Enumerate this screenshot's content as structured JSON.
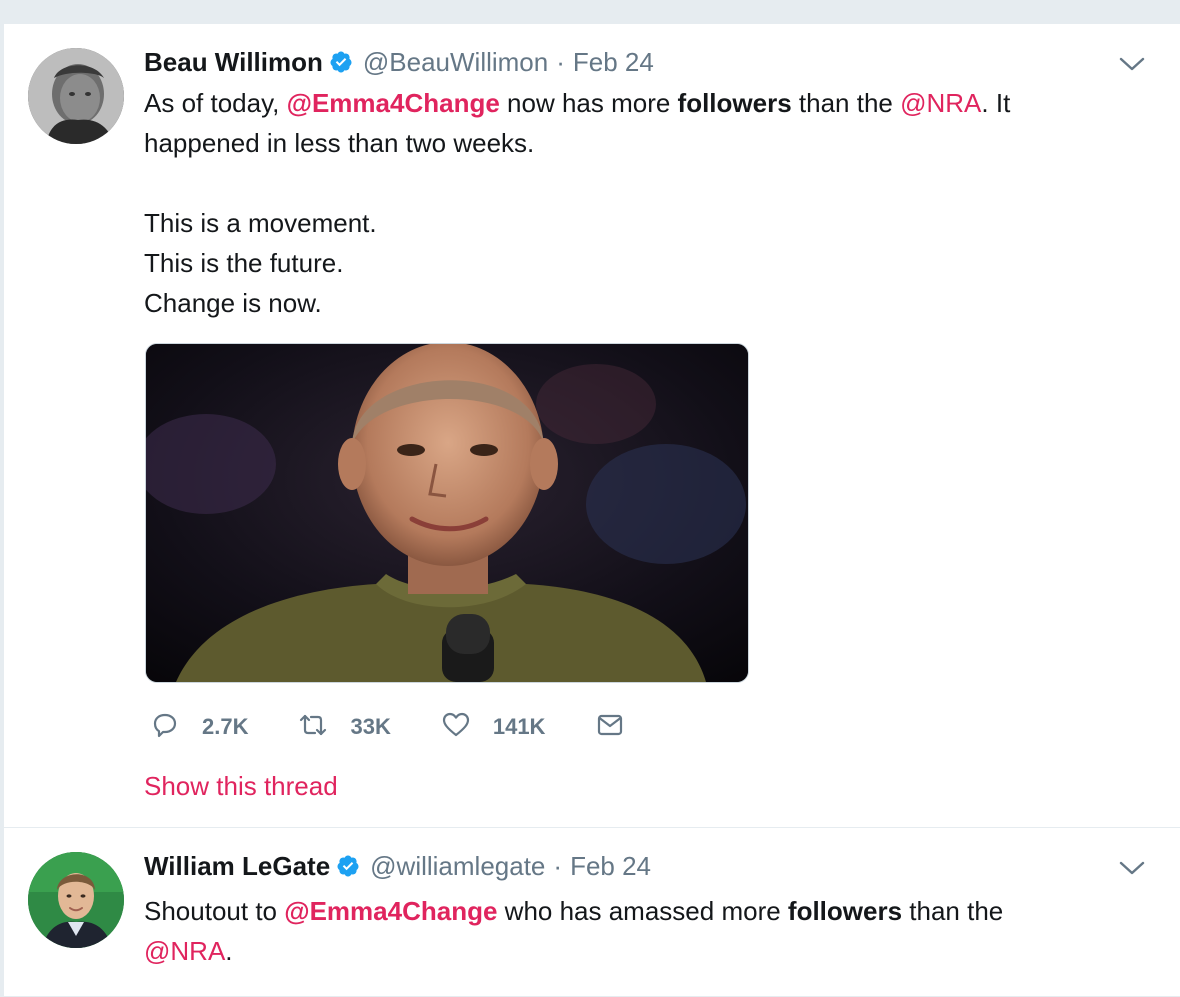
{
  "tweets": [
    {
      "name": "Beau Willimon",
      "handle": "@BeauWillimon",
      "separator": "·",
      "date": "Feb 24",
      "text": {
        "l1_a": "As of today, ",
        "l1_m1": "@Emma4Change",
        "l1_b": " now has more ",
        "l1_kw": "followers",
        "l1_c": " than the ",
        "l1_m2": "@NRA",
        "l1_d": ". It",
        "l2": "happened in less than two weeks.",
        "l4": "This is a movement.",
        "l5": "This is the future.",
        "l6": "Change is now."
      },
      "media": {
        "description_icon": "photo"
      },
      "actions": {
        "replies": "2.7K",
        "retweets": "33K",
        "likes": "141K"
      },
      "show_thread": "Show this thread"
    },
    {
      "name": "William LeGate",
      "handle": "@williamlegate",
      "separator": "·",
      "date": "Feb 24",
      "text": {
        "l1_a": "Shoutout to ",
        "l1_m1": "@Emma4Change",
        "l1_b": " who has amassed more ",
        "l1_kw": "followers",
        "l1_c": " than the",
        "l2_m": "@NRA",
        "l2_b": "."
      }
    }
  ],
  "icons": {
    "verified": "verified-badge-icon",
    "caret": "chevron-down-icon",
    "reply": "reply-icon",
    "retweet": "retweet-icon",
    "like": "heart-icon",
    "dm": "envelope-icon"
  },
  "colors": {
    "mention": "#e0245e",
    "muted": "#657786",
    "verified": "#1da1f2",
    "background": "#e6ecf0"
  }
}
